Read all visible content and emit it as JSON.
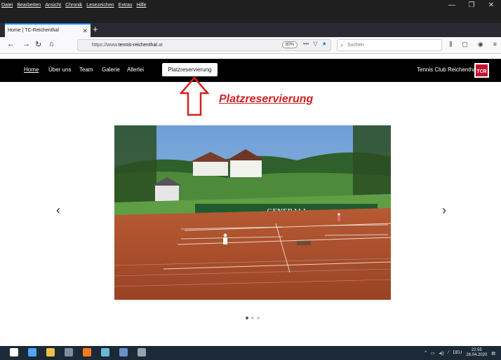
{
  "browser": {
    "menu": [
      "Datei",
      "Bearbeiten",
      "Ansicht",
      "Chronik",
      "Lesezeichen",
      "Extras",
      "Hilfe"
    ],
    "tab_title": "Home | TC-Reichenthal",
    "url_prefix": "https://www.",
    "url_domain": "tennis-reichenthal",
    "url_suffix": ".at",
    "zoom": "80%",
    "search_placeholder": "Suchen",
    "colors": {
      "tab_accent": "#0a84ff",
      "chrome_dark": "#1f1f1f"
    }
  },
  "site": {
    "nav": [
      "Home",
      "Über uns",
      "Team",
      "Galerie",
      "Allerlei"
    ],
    "reservation_button": "Platzreservierung",
    "club_name": "Tennis Club Reichenthal",
    "logo_text": "TCR",
    "annotation": "Platzreservierung",
    "banner_text": "GENERALI",
    "carousel_prev": "‹",
    "carousel_next": "›",
    "active_slide": 1,
    "slide_count": 3,
    "colors": {
      "annotation": "#d42020",
      "nav_bg": "#000000",
      "court": "#b5532c"
    }
  },
  "taskbar": {
    "tray_lang": "DEU",
    "clock_time": "22:55",
    "clock_date": "28.04.2020"
  }
}
